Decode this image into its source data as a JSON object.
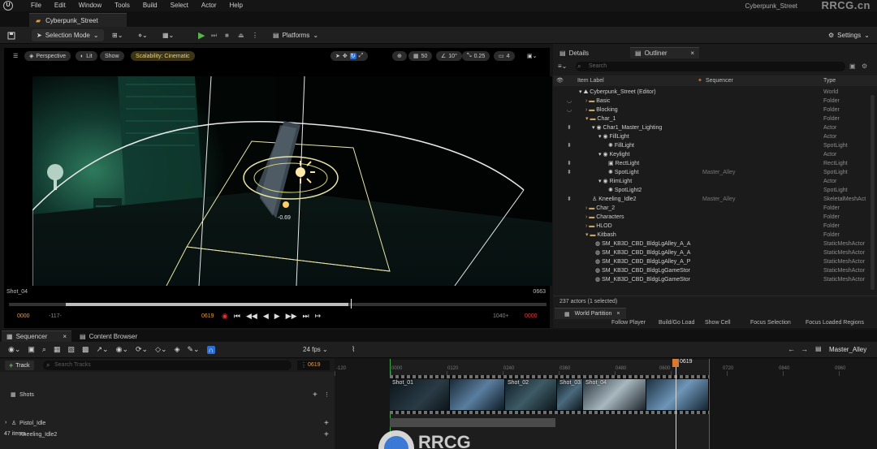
{
  "menubar": {
    "items": [
      "File",
      "Edit",
      "Window",
      "Tools",
      "Build",
      "Select",
      "Actor",
      "Help"
    ],
    "project_name": "Cyberpunk_Street",
    "watermark": "RRCG.cn"
  },
  "level_tab": {
    "label": "Cyberpunk_Street"
  },
  "toolbar": {
    "selection_mode": "Selection Mode",
    "platforms": "Platforms",
    "settings": "Settings"
  },
  "viewport": {
    "perspective": "Perspective",
    "lit": "Lit",
    "show": "Show",
    "scalability": "Scalability: Cinematic",
    "grid_snap": "50",
    "rot_snap": "10°",
    "scale_snap": "0.25",
    "cam_speed": "4",
    "shot_label": "Shot_04",
    "end_frame": "0663",
    "scrub_progress": 0.63,
    "transport": {
      "start": "0000",
      "in": "-117-",
      "current": "0619",
      "out": "1040+",
      "end": "0000"
    },
    "gizmo_value": "-0.69"
  },
  "details_tab": "Details",
  "outliner": {
    "tab_label": "Outliner",
    "search_placeholder": "Search",
    "col_item_label": "Item Label",
    "col_sequencer": "Sequencer",
    "col_type": "Type",
    "actor_count": "237 actors (1 selected)",
    "rows": [
      {
        "label": "Cyberpunk_Street (Editor)",
        "type": "World",
        "sequencer": ""
      },
      {
        "label": "Basic",
        "type": "Folder",
        "sequencer": ""
      },
      {
        "label": "Blocking",
        "type": "Folder",
        "sequencer": ""
      },
      {
        "label": "Char_1",
        "type": "Folder",
        "sequencer": ""
      },
      {
        "label": "Char1_Master_Lighting",
        "type": "Actor",
        "sequencer": ""
      },
      {
        "label": "FillLight",
        "type": "Actor",
        "sequencer": ""
      },
      {
        "label": "FillLight",
        "type": "SpotLight",
        "sequencer": ""
      },
      {
        "label": "Keylight",
        "type": "Actor",
        "sequencer": ""
      },
      {
        "label": "RectLight",
        "type": "RectLight",
        "sequencer": ""
      },
      {
        "label": "SpotLight",
        "type": "SpotLight",
        "sequencer": "Master_Alley"
      },
      {
        "label": "RimLight",
        "type": "Actor",
        "sequencer": ""
      },
      {
        "label": "SpotLight2",
        "type": "SpotLight",
        "sequencer": ""
      },
      {
        "label": "Kneeling_Idle2",
        "type": "SkeletalMeshAct",
        "sequencer": "Master_Alley"
      },
      {
        "label": "Char_2",
        "type": "Folder",
        "sequencer": ""
      },
      {
        "label": "Characters",
        "type": "Folder",
        "sequencer": ""
      },
      {
        "label": "HLOD",
        "type": "Folder",
        "sequencer": ""
      },
      {
        "label": "Kitbash",
        "type": "Folder",
        "sequencer": ""
      },
      {
        "label": "SM_KB3D_CBD_BldgLgAlley_A_A",
        "type": "StaticMeshActor",
        "sequencer": ""
      },
      {
        "label": "SM_KB3D_CBD_BldgLgAlley_A_A",
        "type": "StaticMeshActor",
        "sequencer": ""
      },
      {
        "label": "SM_KB3D_CBD_BldgLgAlley_A_P",
        "type": "StaticMeshActor",
        "sequencer": ""
      },
      {
        "label": "SM_KB3D_CBD_BldgLgGameStor",
        "type": "StaticMeshActor",
        "sequencer": ""
      },
      {
        "label": "SM_KB3D_CBD_BldgLgGameStor",
        "type": "StaticMeshActor",
        "sequencer": ""
      }
    ]
  },
  "world_partition": {
    "tab_label": "World Partition",
    "buttons": [
      "Follow Player",
      "Build/Go Load",
      "Show Cell",
      "Focus Selection",
      "Focus Loaded Regions"
    ]
  },
  "bottom_tabs": {
    "sequencer": "Sequencer",
    "content_browser": "Content Browser"
  },
  "sequencer": {
    "fps": "24 fps",
    "sequence_name": "Master_Alley",
    "track_button": "Track",
    "search_placeholder": "Search Tracks",
    "current_frame": "0619",
    "tracks": [
      "Shots",
      "Pistol_Idle",
      "Kneeling_Idle2"
    ],
    "item_count": "47 items",
    "ruler_labels": [
      "-120",
      "0000",
      "0120",
      "0240",
      "0360",
      "0480",
      "0600",
      "0720",
      "0840",
      "0960"
    ],
    "playhead_label": "0619",
    "shots": [
      {
        "name": "Shot_01"
      },
      {
        "name": "Shot_02"
      },
      {
        "name": "Shot_03"
      },
      {
        "name": "Shot_04"
      }
    ],
    "bottom_watermark": "RRCG"
  },
  "colors": {
    "accent_green": "#58b648",
    "playhead_orange": "#d97a30",
    "folder": "#c8a36a",
    "selection_blue": "#2a6fd6"
  }
}
